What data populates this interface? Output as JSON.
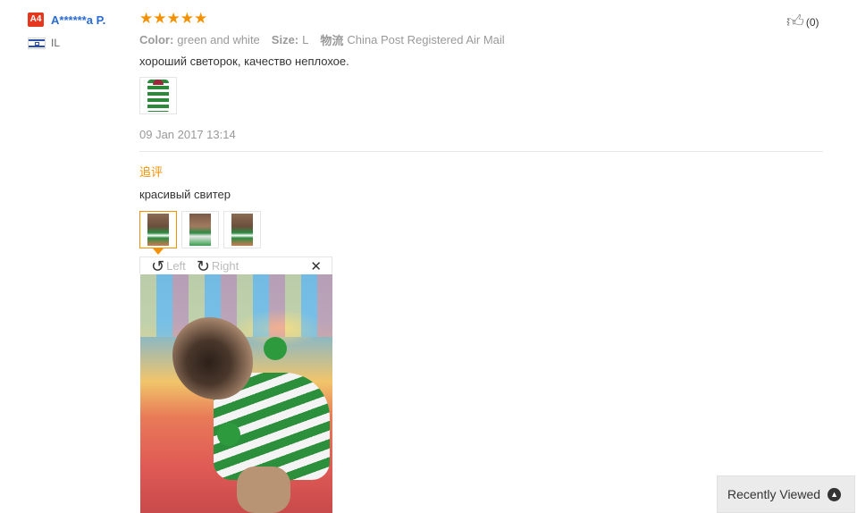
{
  "buyer": {
    "level_badge": "A4",
    "name": "A******a P.",
    "country": "IL",
    "flag_icon": "israel-flag-icon"
  },
  "review": {
    "rating": 5,
    "stars": [
      "★",
      "★",
      "★",
      "★",
      "★"
    ],
    "color_label": "Color:",
    "color_value": "green and white",
    "size_label": "Size:",
    "size_value": "L",
    "logistics_label": "物流",
    "logistics_value": "China Post Registered Air Mail",
    "text": "хороший светорок, качество неплохое.",
    "photos": [
      "sweater-photo"
    ],
    "date": "09 Jan 2017 13:14"
  },
  "followup": {
    "title": "追评",
    "text": "красивый свитер",
    "photos": [
      "dog-photo-1",
      "dog-photo-2",
      "dog-photo-3"
    ],
    "selected_index": 0
  },
  "viewer": {
    "rotate_left_label": "Left",
    "rotate_right_label": "Right",
    "close_icon": "close-icon"
  },
  "helpful": {
    "count": "(0)",
    "icon": "thumbs-up-icon"
  },
  "recently_viewed": {
    "label": "Recently Viewed",
    "icon": "chevron-up-icon"
  },
  "colors": {
    "accent": "#f29203",
    "name_link": "#2a6bd1",
    "badge": "#e5371d"
  }
}
